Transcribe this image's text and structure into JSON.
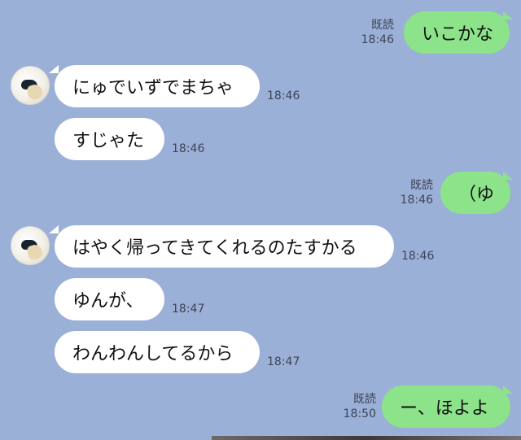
{
  "messages": [
    {
      "text": "いこかな",
      "read": "既読",
      "time": "18:46"
    },
    {
      "text": "にゅでいずでまちゃ",
      "time": "18:46"
    },
    {
      "text": "すじゃた",
      "time": "18:46"
    },
    {
      "text": "（ゆ",
      "read": "既読",
      "time": "18:46"
    },
    {
      "text": "はやく帰ってきてくれるのたすかる",
      "time": "18:46"
    },
    {
      "text": "ゆんが、",
      "time": "18:47"
    },
    {
      "text": "わんわんしてるから",
      "time": "18:47"
    },
    {
      "text": "ー、ほよよ",
      "read": "既読",
      "time": "18:50"
    }
  ],
  "colors": {
    "background": "#9bb0d7",
    "outgoing_bubble": "#8ce38a",
    "incoming_bubble": "#ffffff"
  }
}
